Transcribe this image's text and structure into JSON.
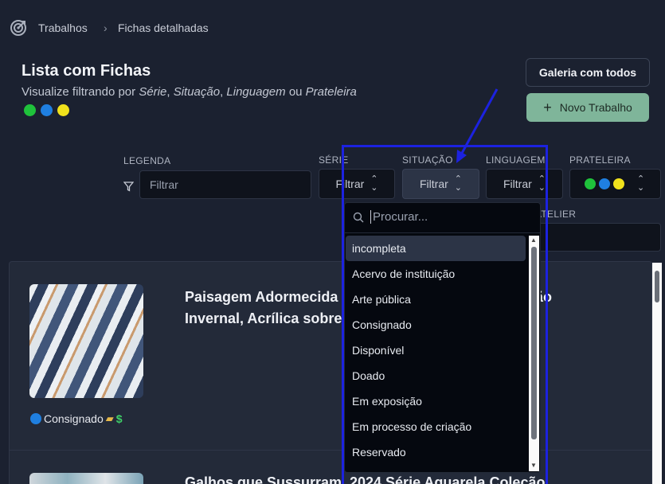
{
  "breadcrumb": {
    "items": [
      "Trabalhos",
      "Fichas detalhadas"
    ],
    "separator": "›"
  },
  "header": {
    "title": "Lista com Fichas",
    "subtitle_prefix": "Visualize filtrando por",
    "subtitle_terms": [
      "Série",
      "Situação",
      "Linguagem",
      "Prateleira"
    ],
    "subtitle_or": "ou",
    "status_dots": [
      "#1fc23b",
      "#1f7fe0",
      "#f1e21c"
    ]
  },
  "actions": {
    "gallery_label": "Galeria com todos",
    "new_label": "Novo Trabalho"
  },
  "filters": {
    "legenda_label": "LEGENDA",
    "legenda_placeholder": "Filtrar",
    "serie_label": "SÉRIE",
    "serie_value": "Filtrar",
    "situacao_label": "SITUAÇÃO",
    "situacao_value": "Filtrar",
    "linguagem_label": "LINGUAGEM",
    "linguagem_value": "Filtrar",
    "prateleira_label": "PRATELEIRA",
    "atelier_label": "ATELIER"
  },
  "dropdown": {
    "search_placeholder": "Procurar...",
    "options": [
      "incompleta",
      "Acervo de instituição",
      "Arte pública",
      "Consignado",
      "Disponível",
      "Doado",
      "Em exposição",
      "Em processo de criação",
      "Reservado"
    ],
    "highlighted_index": 0
  },
  "cards": [
    {
      "title": "Paisagem Adormecida ... Invernal, Acrílica sobre ...",
      "title_line1": "Paisagem Adormecida",
      "title_line1_tail": "ão",
      "title_line2": "Invernal, Acrílica sobre",
      "status": "Consignado",
      "status_color": "#1f7fe0",
      "currency": "$"
    },
    {
      "title_start": "Galhos que Sussurram",
      "title_end": "2024 Série Aquarela Coleção"
    }
  ],
  "colors": {
    "accent_green": "#7fb59a",
    "annotation": "#1c22e0"
  }
}
